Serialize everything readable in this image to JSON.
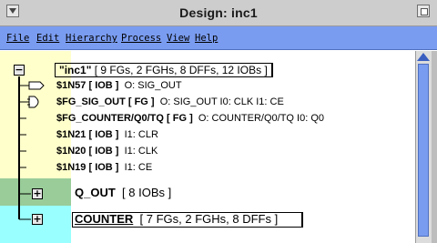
{
  "window": {
    "title": "Design: inc1"
  },
  "menubar": {
    "items": [
      "File",
      "Edit",
      "Hierarchy",
      "Process",
      "View",
      "Help"
    ]
  },
  "tree": {
    "root": {
      "name": "\"inc1\"",
      "detail": "[ 9 FGs, 2 FGHs, 8 DFFs, 12 IOBs ]",
      "expander": "−"
    },
    "nodes": [
      {
        "name": "$1N57 [ IOB ]",
        "detail": "O: SIG_OUT"
      },
      {
        "name": "$FG_SIG_OUT [ FG ]",
        "detail": "O: SIG_OUT I0: CLK I1: CE"
      },
      {
        "name": "$FG_COUNTER/Q0/TQ [ FG ]",
        "detail": "O: COUNTER/Q0/TQ I0: Q0"
      },
      {
        "name": "$1N21 [ IOB ]",
        "detail": "I1: CLR"
      },
      {
        "name": "$1N20 [ IOB ]",
        "detail": "I1: CLK"
      },
      {
        "name": "$1N19 [ IOB ]",
        "detail": "I1: CE"
      }
    ],
    "groups": [
      {
        "name": "Q_OUT",
        "detail": "[ 8 IOBs ]",
        "expander": "+"
      },
      {
        "name": "COUNTER",
        "detail": "[ 7 FGs, 2 FGHs, 8 DFFs ]",
        "expander": "+"
      }
    ]
  },
  "colors": {
    "menubar": "#7a9cf0",
    "panel_yellow": "#ffffcc",
    "panel_green": "#99cc99",
    "panel_cyan": "#99ffff"
  }
}
